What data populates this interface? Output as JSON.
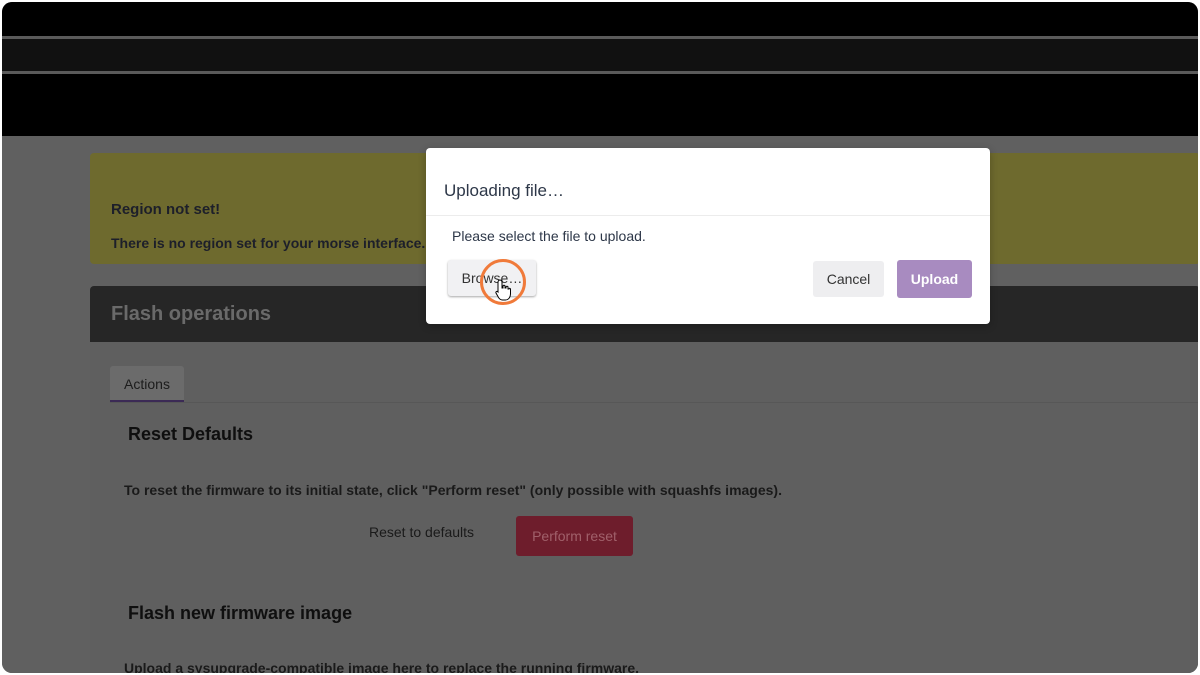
{
  "alert": {
    "title": "Region not set!",
    "message": "There is no region set for your morse interface. P"
  },
  "flash": {
    "section_title": "Flash operations",
    "tab_actions": "Actions",
    "reset_title": "Reset Defaults",
    "reset_desc": "To reset the firmware to its initial state, click \"Perform reset\" (only possible with squashfs images).",
    "reset_label": "Reset to defaults",
    "perform_reset": "Perform reset",
    "flash_title": "Flash new firmware image",
    "flash_desc": "Upload a sysupgrade-compatible image here to replace the running firmware."
  },
  "modal": {
    "title": "Uploading file…",
    "message": "Please select the file to upload.",
    "browse": "Browse…",
    "cancel": "Cancel",
    "upload": "Upload"
  },
  "colors": {
    "upload_button": "#a88bc0",
    "click_highlight": "#f07a3a",
    "perform_reset": "#6e1d2c"
  }
}
